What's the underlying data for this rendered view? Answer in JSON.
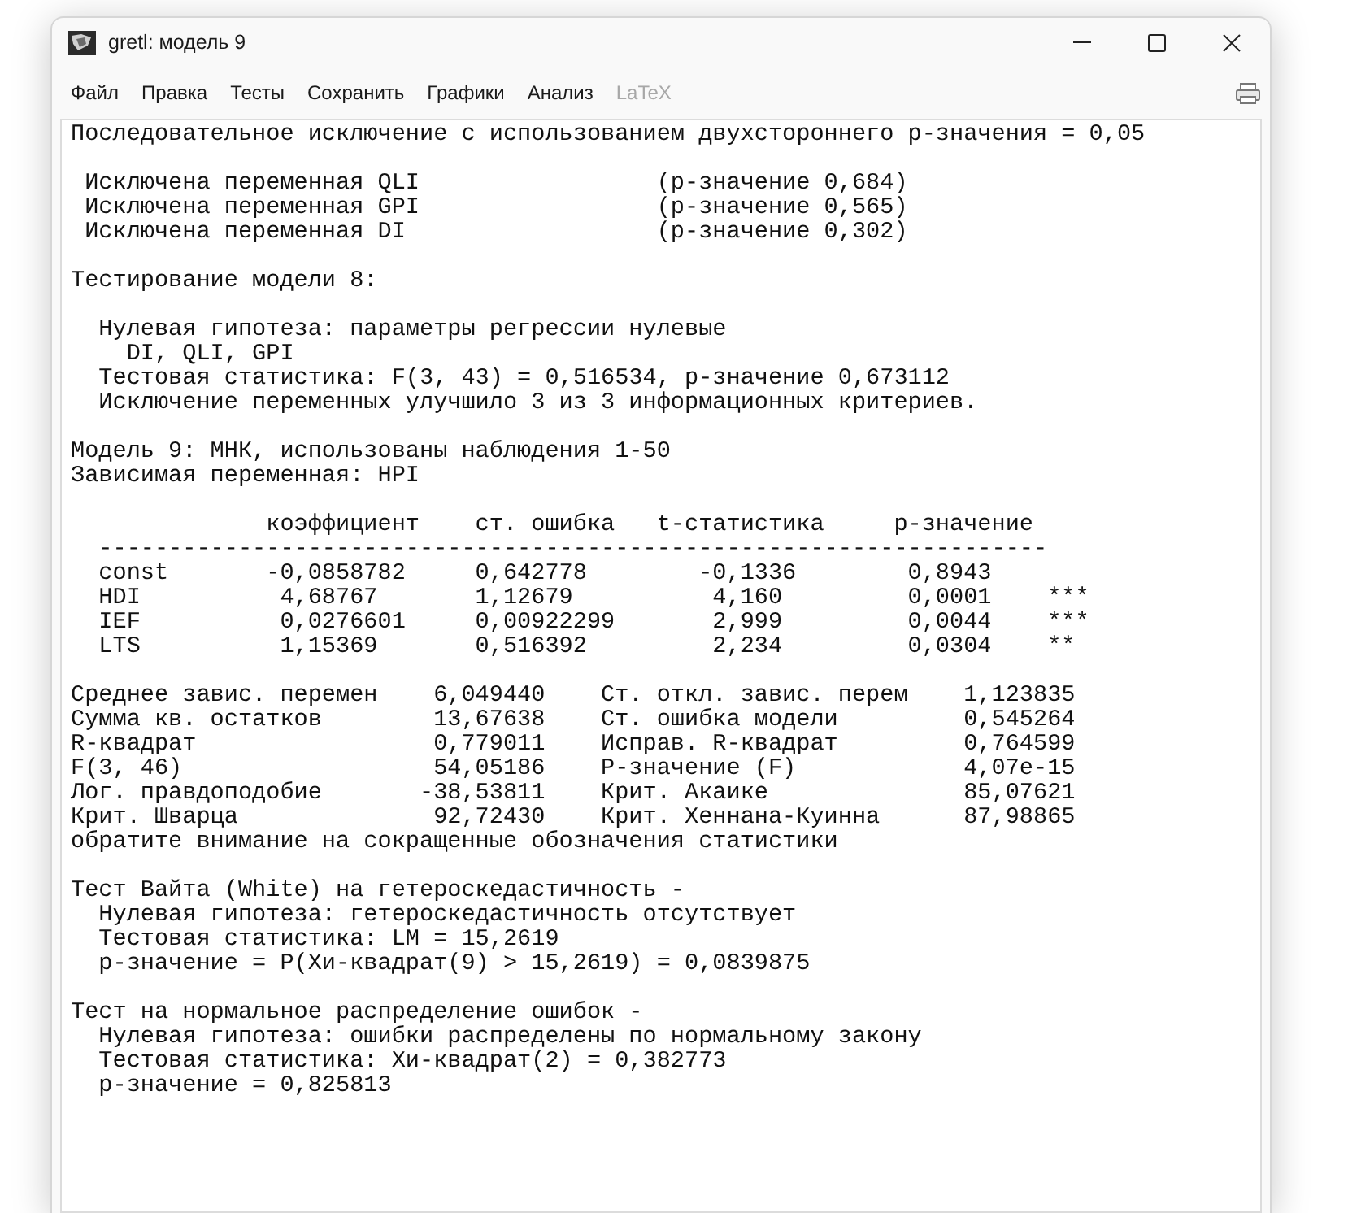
{
  "window": {
    "title": "gretl: модель 9"
  },
  "menu": [
    {
      "label": "Файл",
      "disabled": false
    },
    {
      "label": "Правка",
      "disabled": false
    },
    {
      "label": "Тесты",
      "disabled": false
    },
    {
      "label": "Сохранить",
      "disabled": false
    },
    {
      "label": "Графики",
      "disabled": false
    },
    {
      "label": "Анализ",
      "disabled": false
    },
    {
      "label": "LaTeX",
      "disabled": true
    }
  ],
  "output": {
    "sections": [
      {
        "lines": [
          "Последовательное исключение с использованием двухстороннего p-значения = 0,05"
        ]
      },
      {
        "lines": [
          " Исключена переменная QLI                 (p-значение 0,684)",
          " Исключена переменная GPI                 (p-значение 0,565)",
          " Исключена переменная DI                  (p-значение 0,302)"
        ]
      },
      {
        "lines": [
          "Тестирование модели 8:"
        ]
      },
      {
        "lines": [
          "  Нулевая гипотеза: параметры регрессии нулевые",
          "    DI, QLI, GPI",
          "  Тестовая статистика: F(3, 43) = 0,516534, p-значение 0,673112",
          "  Исключение переменных улучшило 3 из 3 информационных критериев."
        ]
      },
      {
        "lines": [
          "Модель 9: МНК, использованы наблюдения 1-50",
          "Зависимая переменная: HPI"
        ]
      },
      {
        "lines": [
          "              коэффициент    ст. ошибка   t-статистика     p-значение",
          "  --------------------------------------------------------------------",
          "  const       -0,0858782     0,642778        -0,1336        0,8943",
          "  HDI          4,68767       1,12679          4,160         0,0001    ***",
          "  IEF          0,0276601     0,00922299       2,999         0,0044    ***",
          "  LTS          1,15369       0,516392         2,234         0,0304    **"
        ]
      },
      {
        "lines": [
          "Среднее завис. перемен    6,049440    Ст. откл. завис. перем    1,123835",
          "Сумма кв. остатков        13,67638    Ст. ошибка модели         0,545264",
          "R-квадрат                 0,779011    Исправ. R-квадрат         0,764599",
          "F(3, 46)                  54,05186    P-значение (F)            4,07e-15",
          "Лог. правдоподобие       -38,53811    Крит. Акаике              85,07621",
          "Крит. Шварца              92,72430    Крит. Хеннана-Куинна      87,98865",
          "обратите внимание на сокращенные обозначения статистики"
        ]
      },
      {
        "lines": [
          "Тест Вайта (White) на гетероскедастичность -",
          "  Нулевая гипотеза: гетероскедастичность отсутствует",
          "  Тестовая статистика: LM = 15,2619",
          "  p-значение = P(Хи-квадрат(9) > 15,2619) = 0,0839875"
        ]
      },
      {
        "lines": [
          "Тест на нормальное распределение ошибок -",
          "  Нулевая гипотеза: ошибки распределены по нормальному закону",
          "  Тестовая статистика: Хи-квадрат(2) = 0,382773",
          "  p-значение = 0,825813"
        ]
      }
    ]
  }
}
